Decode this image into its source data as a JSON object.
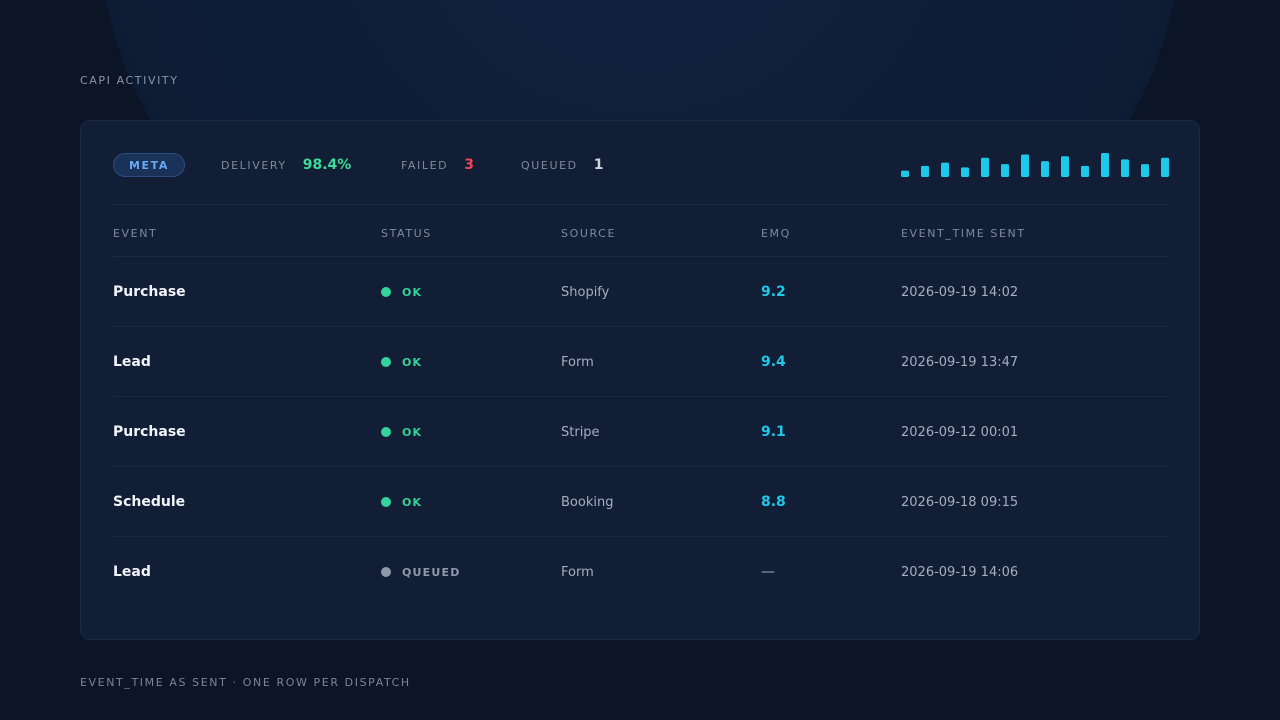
{
  "page": {
    "title": "CAPI ACTIVITY",
    "footer": "EVENT_TIME AS SENT · ONE ROW PER DISPATCH"
  },
  "summary": {
    "platform_badge": "META",
    "delivery": {
      "label": "DELIVERY",
      "value": "98.4%",
      "color": "#3ddc97"
    },
    "failed": {
      "label": "FAILED",
      "value": "3",
      "color": "#f0455a"
    },
    "queued": {
      "label": "QUEUED",
      "value": "1",
      "color": "#d0d6df"
    },
    "sparkline_color": "#1ec8ea",
    "sparkline_relative_heights": [
      0.33,
      0.58,
      0.75,
      0.5,
      1.0,
      0.67,
      1.17,
      0.83,
      1.08,
      0.58,
      1.25,
      0.92,
      0.67,
      1.0
    ]
  },
  "table": {
    "columns": [
      "EVENT",
      "STATUS",
      "SOURCE",
      "EMQ",
      "EVENT_TIME SENT"
    ],
    "rows": [
      {
        "event": "Purchase",
        "status": "OK",
        "status_color": "#34d399",
        "source": "Shopify",
        "emq": "9.2",
        "time": "2026-09-19 14:02"
      },
      {
        "event": "Lead",
        "status": "OK",
        "status_color": "#34d399",
        "source": "Form",
        "emq": "9.4",
        "time": "2026-09-19 13:47"
      },
      {
        "event": "Purchase",
        "status": "OK",
        "status_color": "#34d399",
        "source": "Stripe",
        "emq": "9.1",
        "time": "2026-09-12 00:01"
      },
      {
        "event": "Schedule",
        "status": "OK",
        "status_color": "#34d399",
        "source": "Booking",
        "emq": "8.8",
        "time": "2026-09-18 09:15"
      },
      {
        "event": "Lead",
        "status": "QUEUED",
        "status_color": "#8f99ab",
        "source": "Form",
        "emq": "—",
        "time": "2026-09-19 14:06"
      }
    ]
  }
}
